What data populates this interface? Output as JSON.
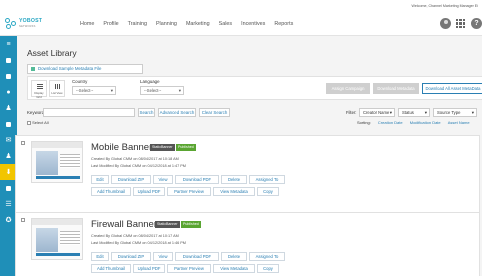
{
  "welcome": "Welcome, Channel Marketing Manager Ei",
  "logo": {
    "line1": "YOBOST",
    "line2": "NETWORKS"
  },
  "nav": [
    "Home",
    "Profile",
    "Training",
    "Planning",
    "Marketing",
    "Sales",
    "Incentives",
    "Reports"
  ],
  "page_title": "Asset Library",
  "download_sample": "Download Sample Metadata File",
  "filters": {
    "grid_view_label": "Display Grid",
    "list_view_label": "List View",
    "country_label": "Country",
    "country_value": "--Select--",
    "language_label": "Language",
    "language_value": "--Select--",
    "assign_campaign": "Assign Campaign",
    "download_metadata": "Download Metadata",
    "download_all_metadata": "Download All Asset MetaData"
  },
  "search": {
    "keyword_label": "Keyword",
    "search_btn": "Search",
    "advanced_btn": "Advanced Search",
    "clear_btn": "Clear Search",
    "filter_label": "Filter:",
    "creator_select": "Creator Name",
    "status_select": "Status",
    "source_select": "Source Type"
  },
  "sort": {
    "select_all": "Select All",
    "sorting_label": "Sorting:",
    "creation_date": "Creation Date",
    "modification_date": "Modification Date",
    "asset_name": "Asset Name"
  },
  "assets": [
    {
      "title": "Mobile Banner",
      "badge_type": "StaticBanner",
      "badge_status": "Published",
      "created": "Created By Global CMM on 08/04/2017 at 10:18 AM",
      "modified": "Last Modified By Global CMM on 04/12/2018 at 1:47 PM",
      "actions_row1": [
        "Edit",
        "Download ZIP",
        "View",
        "Download PDF",
        "Delete",
        "Assigned To"
      ],
      "actions_row2": [
        "Add Thumbnail",
        "Upload PDF",
        "Partner Preview",
        "View Metadata",
        "Copy"
      ]
    },
    {
      "title": "Firewall Banner",
      "badge_type": "StaticBanner",
      "badge_status": "Published",
      "created": "Created By Global CMM on 08/04/2017 at 10:17 AM",
      "modified": "Last Modified By Global CMM on 04/12/2018 at 1:46 PM",
      "actions_row1": [
        "Edit",
        "Download ZIP",
        "View",
        "Download PDF",
        "Delete",
        "Assigned To"
      ],
      "actions_row2": [
        "Add Thumbnail",
        "Upload PDF",
        "Partner Preview",
        "View Metadata",
        "Copy"
      ]
    }
  ],
  "colors": {
    "sidebar": "#1f8fb8",
    "sidebar_active": "#f2c500",
    "accent": "#2a7fb3",
    "published": "#5aa532"
  }
}
